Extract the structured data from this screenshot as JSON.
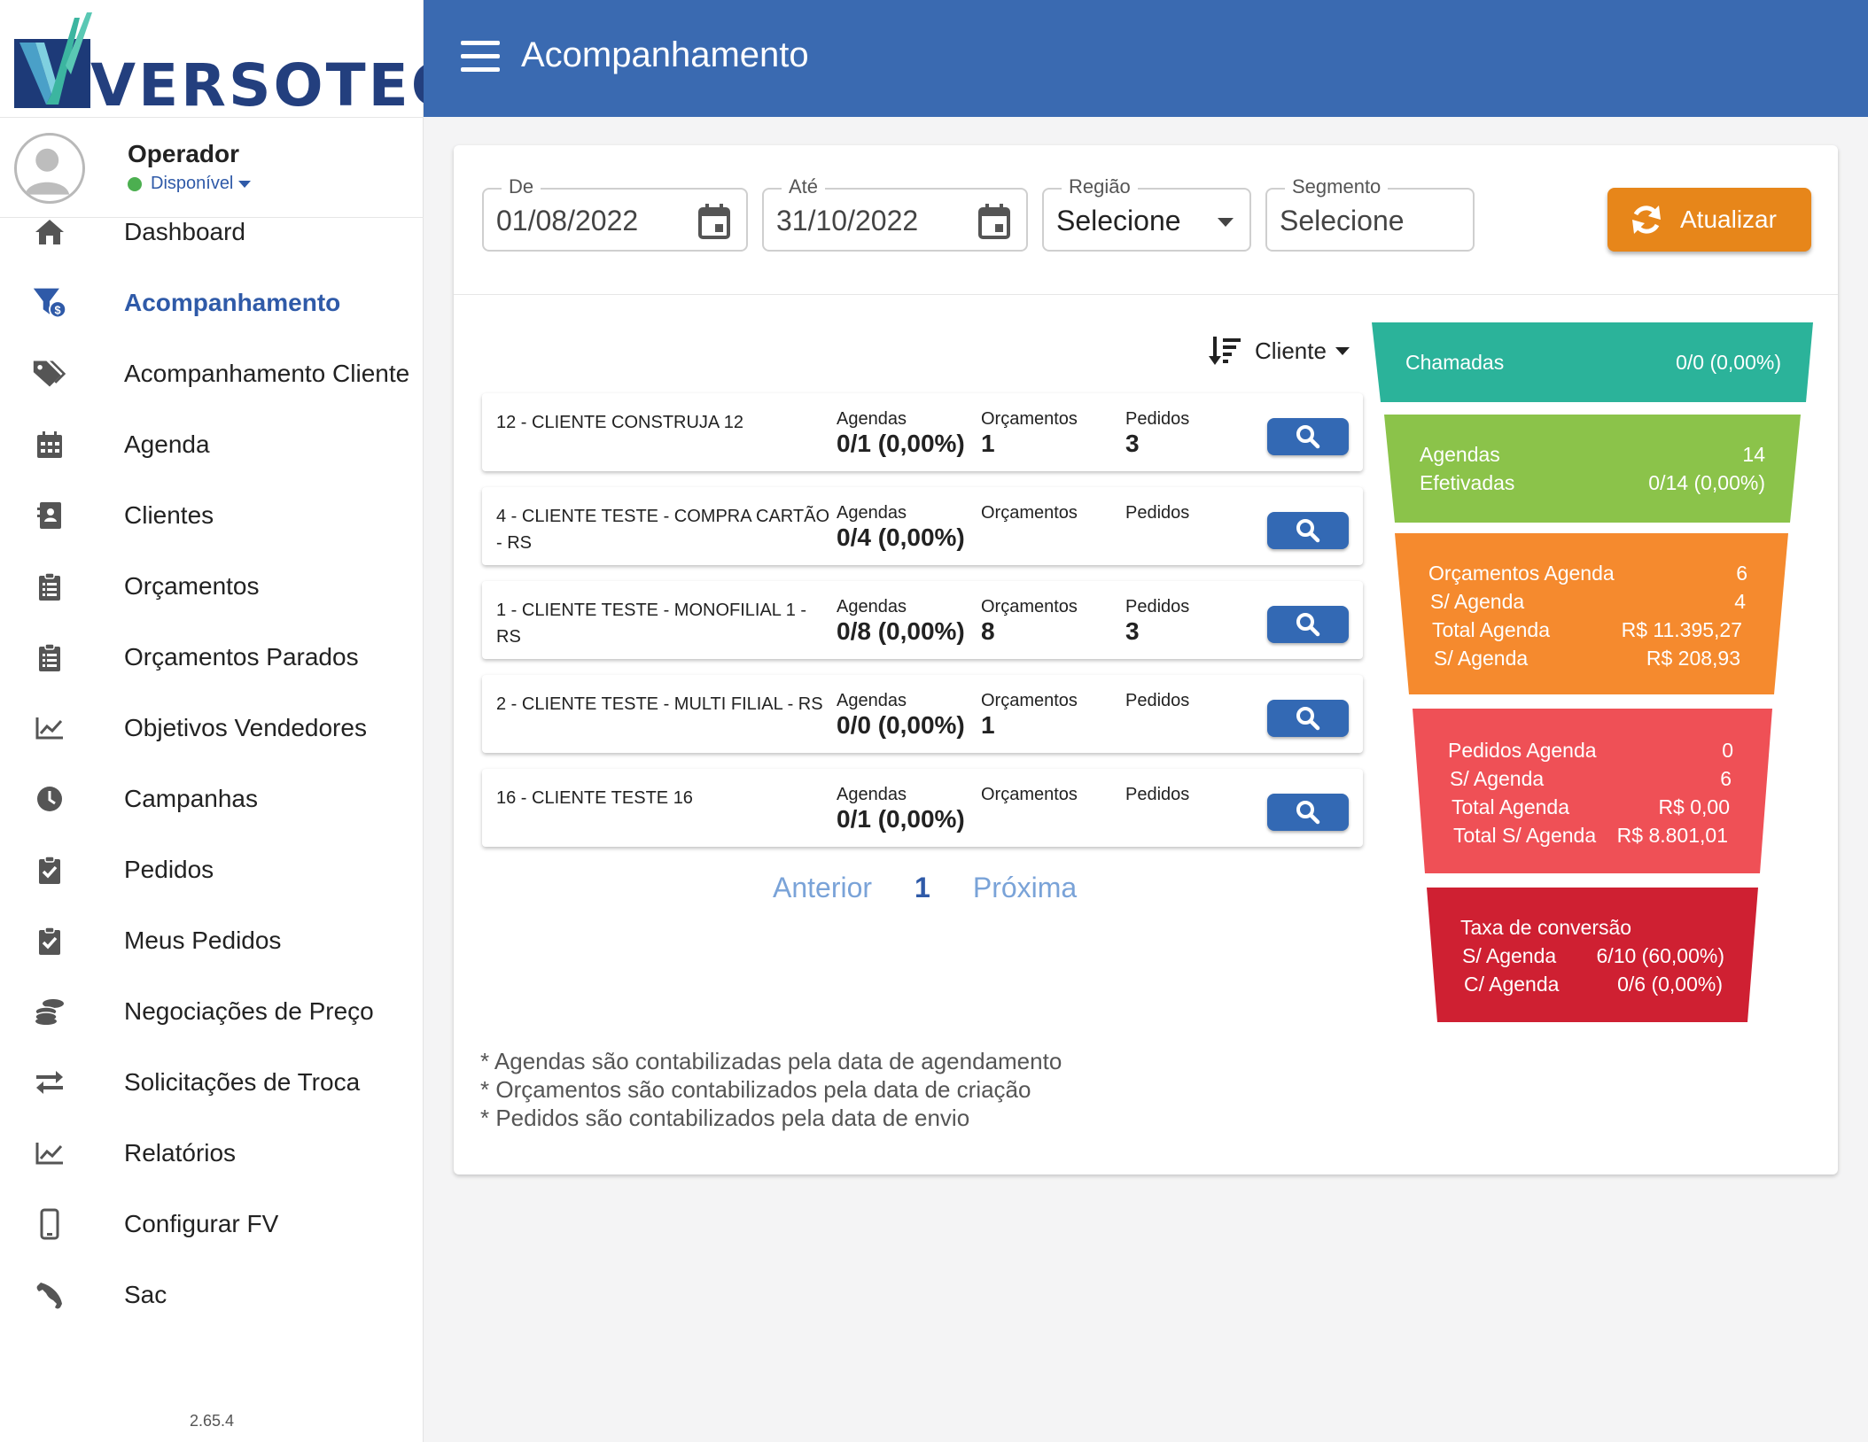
{
  "brand": {
    "logo_text": "VERSOTECH",
    "colors": {
      "primary": "#3a6ab1",
      "accent": "#e7861a"
    }
  },
  "user": {
    "name": "Operador",
    "status": "Disponível"
  },
  "menu": [
    {
      "label": "Dashboard",
      "icon": "home-icon",
      "active": false
    },
    {
      "label": "Acompanhamento",
      "icon": "funnel-dollar-icon",
      "active": true
    },
    {
      "label": "Acompanhamento Cliente",
      "icon": "tags-icon",
      "active": false
    },
    {
      "label": "Agenda",
      "icon": "calendar-icon",
      "active": false
    },
    {
      "label": "Clientes",
      "icon": "contact-book-icon",
      "active": false
    },
    {
      "label": "Orçamentos",
      "icon": "clipboard-list-icon",
      "active": false
    },
    {
      "label": "Orçamentos Parados",
      "icon": "clipboard-list-icon",
      "active": false
    },
    {
      "label": "Objetivos Vendedores",
      "icon": "line-chart-icon",
      "active": false
    },
    {
      "label": "Campanhas",
      "icon": "clock-icon",
      "active": false
    },
    {
      "label": "Pedidos",
      "icon": "clipboard-check-icon",
      "active": false
    },
    {
      "label": "Meus Pedidos",
      "icon": "clipboard-check-icon",
      "active": false
    },
    {
      "label": "Negociações de Preço",
      "icon": "coins-icon",
      "active": false
    },
    {
      "label": "Solicitações de Troca",
      "icon": "exchange-icon",
      "active": false
    },
    {
      "label": "Relatórios",
      "icon": "line-chart-icon",
      "active": false
    },
    {
      "label": "Configurar FV",
      "icon": "mobile-icon",
      "active": false
    },
    {
      "label": "Sac",
      "icon": "phone-icon",
      "active": false
    }
  ],
  "version": "2.65.4",
  "header": {
    "title": "Acompanhamento"
  },
  "filters": {
    "de": {
      "label": "De",
      "value": "01/08/2022"
    },
    "ate": {
      "label": "Até",
      "value": "31/10/2022"
    },
    "regiao": {
      "label": "Região",
      "value": "Selecione"
    },
    "segmento": {
      "label": "Segmento",
      "value": "Selecione"
    },
    "update_label": "Atualizar"
  },
  "sort": {
    "label": "Cliente"
  },
  "columns": {
    "agendas": "Agendas",
    "orcamentos": "Orçamentos",
    "pedidos": "Pedidos"
  },
  "clients": [
    {
      "name": "12 - CLIENTE CONSTRUJA 12",
      "agendas": "0/1 (0,00%)",
      "orcamentos": "1",
      "pedidos": "3"
    },
    {
      "name": "4 - CLIENTE TESTE - COMPRA CARTÃO - RS",
      "agendas": "0/4 (0,00%)",
      "orcamentos": "",
      "pedidos": ""
    },
    {
      "name": "1 - CLIENTE TESTE - MONOFILIAL 1 - RS",
      "agendas": "0/8 (0,00%)",
      "orcamentos": "8",
      "pedidos": "3"
    },
    {
      "name": "2 - CLIENTE TESTE - MULTI FILIAL - RS",
      "agendas": "0/0 (0,00%)",
      "orcamentos": "1",
      "pedidos": ""
    },
    {
      "name": "16 - CLIENTE TESTE 16",
      "agendas": "0/1 (0,00%)",
      "orcamentos": "",
      "pedidos": ""
    }
  ],
  "pagination": {
    "prev": "Anterior",
    "current": "1",
    "next": "Próxima"
  },
  "notes": [
    "* Agendas são contabilizadas pela data de agendamento",
    "* Orçamentos são contabilizados pela data de criação",
    "* Pedidos são contabilizados pela data de envio"
  ],
  "funnel": {
    "chamadas": {
      "label": "Chamadas",
      "value": "0/0 (0,00%)",
      "color": "#2bb39a"
    },
    "agendas": {
      "label1": "Agendas",
      "value1": "14",
      "label2": "Efetivadas",
      "value2": "0/14 (0,00%)",
      "color": "#8bc34a"
    },
    "orcamentos": {
      "color": "#f58a2e",
      "rows": [
        {
          "label": "Orçamentos Agenda",
          "value": "6"
        },
        {
          "label": "S/ Agenda",
          "value": "4"
        },
        {
          "label": "Total Agenda",
          "value": "R$ 11.395,27"
        },
        {
          "label": "S/ Agenda",
          "value": "R$ 208,93"
        }
      ]
    },
    "pedidos": {
      "color": "#ef5056",
      "rows": [
        {
          "label": "Pedidos Agenda",
          "value": "0"
        },
        {
          "label": "S/ Agenda",
          "value": "6"
        },
        {
          "label": "Total Agenda",
          "value": "R$ 0,00"
        },
        {
          "label": "Total S/ Agenda",
          "value": "R$ 8.801,01"
        }
      ]
    },
    "conversao": {
      "color": "#cf2032",
      "title": "Taxa de conversão",
      "rows": [
        {
          "label": "S/ Agenda",
          "value": "6/10 (60,00%)"
        },
        {
          "label": "C/ Agenda",
          "value": "0/6 (0,00%)"
        }
      ]
    }
  }
}
